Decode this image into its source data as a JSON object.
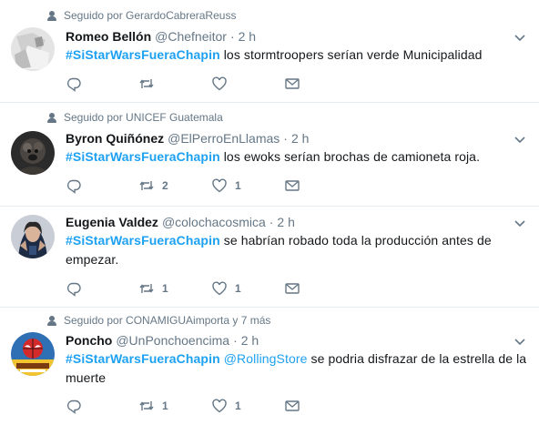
{
  "tweets": [
    {
      "social_context": "Seguido por GerardoCabreraReuss",
      "name": "Romeo Bellón",
      "handle": "@Chefneitor",
      "separator": "·",
      "time": "2 h",
      "hashtag": "#SiStarWarsFueraChapin",
      "text": " los stormtroopers serían verde Municipalidad",
      "replies": "",
      "retweets": "",
      "likes": ""
    },
    {
      "social_context": "Seguido por UNICEF Guatemala",
      "name": "Byron Quiñónez",
      "handle": "@ElPerroEnLlamas",
      "separator": "·",
      "time": "2 h",
      "hashtag": "#SiStarWarsFueraChapin",
      "text": " los ewoks serían brochas de camioneta roja.",
      "replies": "",
      "retweets": "2",
      "likes": "1"
    },
    {
      "social_context": "",
      "name": "Eugenia Valdez",
      "handle": "@colochacosmica",
      "separator": "·",
      "time": "2 h",
      "hashtag": "#SiStarWarsFueraChapin",
      "text": " se habrían robado toda la producción antes de empezar.",
      "replies": "",
      "retweets": "1",
      "likes": "1"
    },
    {
      "social_context": "Seguido por CONAMIGUAimporta y 7 más",
      "name": "Poncho",
      "handle": "@UnPonchoencima",
      "separator": "·",
      "time": "2 h",
      "hashtag": "#SiStarWarsFueraChapin",
      "mention": "@RollingStore",
      "text": " se podria disfrazar de la estrella de la muerte",
      "replies": "",
      "retweets": "1",
      "likes": "1"
    }
  ],
  "icons": {
    "reply": "reply-icon",
    "retweet": "retweet-icon",
    "like": "heart-icon",
    "dm": "envelope-icon",
    "caret": "chevron-down-icon",
    "social": "person-icon"
  },
  "colors": {
    "link": "#1da1f2",
    "secondary": "#657786",
    "text": "#14171a",
    "border": "#e6ecf0"
  }
}
